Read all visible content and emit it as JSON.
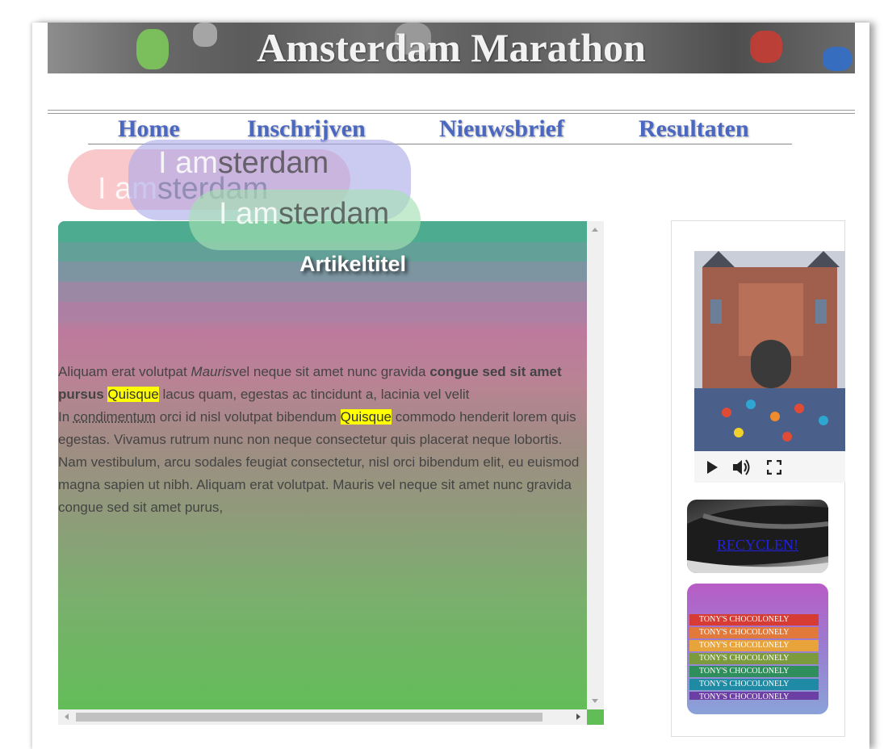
{
  "banner": {
    "title": "Amsterdam Marathon"
  },
  "nav": {
    "items": [
      "Home",
      "Inschrijven",
      "Nieuwsbrief",
      "Resultaten"
    ]
  },
  "pills": [
    {
      "light": "I am",
      "dark": "sterdam",
      "color": "#f5a3a8"
    },
    {
      "light": "I am",
      "dark": "sterdam",
      "color": "#a9a8ea"
    },
    {
      "light": "I am",
      "dark": "sterdam",
      "color": "#a4e0b2"
    }
  ],
  "article": {
    "title": "Artikeltitel",
    "p1_a": "Aliquam erat volutpat ",
    "p1_em": "Mauris",
    "p1_b": "vel neque sit amet nunc gravida ",
    "p1_strong": "congue sed sit amet pursus",
    "p1_mark": "Quisque",
    "p1_c": " lacus quam, egestas ac tincidunt a, lacinia vel velit",
    "p2_a": "In ",
    "p2_abbr": "condimentum",
    "p2_b": " orci id nisl volutpat bibendum ",
    "p2_mark": "Quisque",
    "p2_c": " commodo henderit lorem quis egestas. Vivamus rutrum nunc non neque consectetur quis placerat neque lobortis. Nam vestibulum, arcu sodales feugiat consectetur, nisl orci bibendum elit, eu euismod magna sapien ut nibh. Aliquam erat volutpat. Mauris vel neque sit amet nunc gravida congue sed sit amet purus,"
  },
  "sidebar": {
    "recycle_link": "RECYCLEN!",
    "choco_label": "TONY'S CHOCOLONELY"
  },
  "colors": {
    "nav": "#4a67c1",
    "highlight": "#ffff00"
  },
  "icons": [
    "play-icon",
    "volume-icon",
    "fullscreen-icon"
  ]
}
